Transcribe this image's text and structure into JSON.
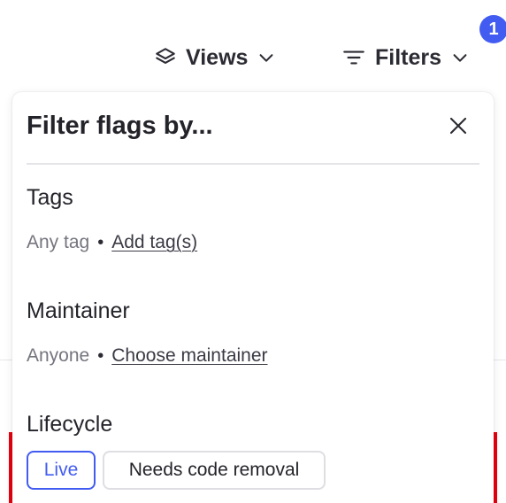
{
  "toolbar": {
    "views_label": "Views",
    "filters_label": "Filters",
    "filter_count": "1"
  },
  "panel": {
    "title": "Filter flags by...",
    "sections": {
      "tags": {
        "heading": "Tags",
        "value": "Any tag",
        "action": "Add tag(s)"
      },
      "maintainer": {
        "heading": "Maintainer",
        "value": "Anyone",
        "action": "Choose maintainer"
      },
      "lifecycle": {
        "heading": "Lifecycle",
        "options": [
          {
            "label": "Live",
            "selected": true
          },
          {
            "label": "Needs code removal",
            "selected": false
          }
        ]
      }
    }
  },
  "colors": {
    "accent": "#425cf2",
    "text": "#23232a",
    "muted": "#75757f",
    "border": "#dedee3",
    "background_accent": "#e8000f"
  },
  "icons": {
    "views": "layers-icon",
    "filters": "filter-lines-icon",
    "dropdown": "chevron-down-icon",
    "close": "close-icon"
  }
}
